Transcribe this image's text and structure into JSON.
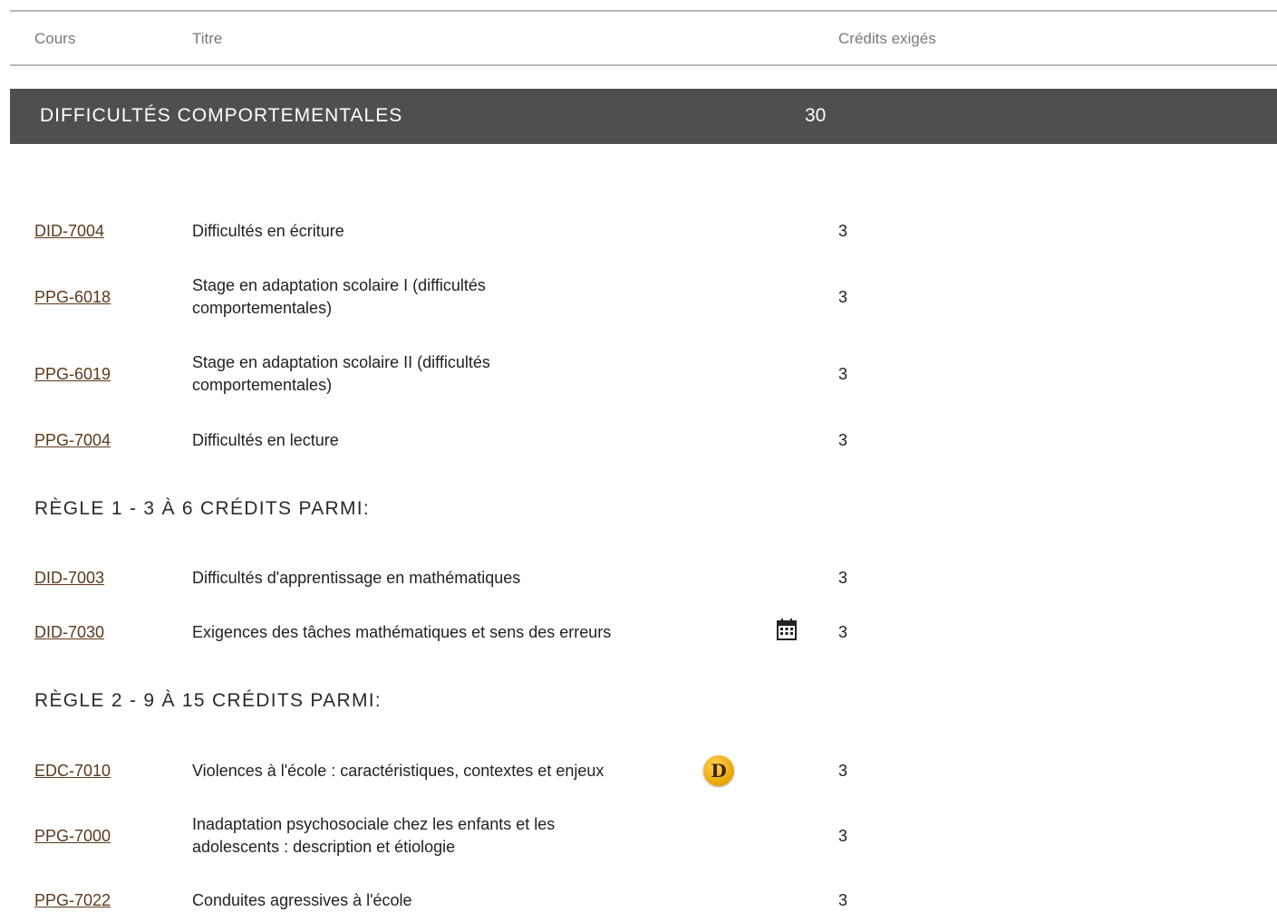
{
  "table_header": {
    "course": "Cours",
    "title": "Titre",
    "credits": "Crédits exigés"
  },
  "section": {
    "title": "DIFFICULTÉS COMPORTEMENTALES",
    "credits": "30"
  },
  "courses": [
    {
      "code": "DID-7004",
      "title": "Difficultés en écriture",
      "credits": "3"
    },
    {
      "code": "PPG-6018",
      "title": "Stage en adaptation scolaire I (difficultés comportementales)",
      "credits": "3"
    },
    {
      "code": "PPG-6019",
      "title": "Stage en adaptation scolaire II (difficultés comportementales)",
      "credits": "3"
    },
    {
      "code": "PPG-7004",
      "title": "Difficultés en lecture",
      "credits": "3"
    }
  ],
  "rule1": {
    "label": "RÈGLE 1 - 3 À 6 CRÉDITS PARMI:",
    "courses": [
      {
        "code": "DID-7003",
        "title": "Difficultés d'apprentissage en mathématiques",
        "credits": "3"
      },
      {
        "code": "DID-7030",
        "title": "Exigences des tâches mathématiques et sens des erreurs",
        "credits": "3",
        "icon": "calendar-icon"
      }
    ]
  },
  "rule2": {
    "label": "RÈGLE 2 - 9 À 15 CRÉDITS PARMI:",
    "courses": [
      {
        "code": "EDC-7010",
        "title": "Violences à l'école : caractéristiques, contextes et enjeux",
        "credits": "3",
        "icon": "distance-course-badge",
        "badge_letter": "D",
        "badge_color": "#e9a400"
      },
      {
        "code": "PPG-7000",
        "title": "Inadaptation psychosociale chez les enfants et les adolescents : description et étiologie",
        "credits": "3"
      },
      {
        "code": "PPG-7022",
        "title": "Conduites agressives à l'école",
        "credits": "3"
      }
    ]
  },
  "colors": {
    "section_bar": "#4f4f4f",
    "link": "#5b3a1a",
    "header_text": "#7a7a7a",
    "divider": "#b9b9b9"
  }
}
